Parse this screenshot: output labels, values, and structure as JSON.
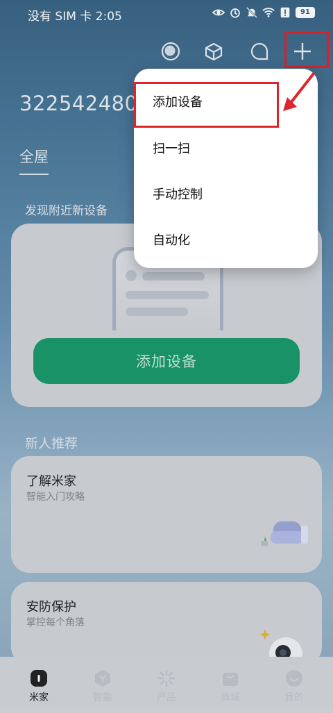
{
  "status": {
    "left_text": "没有 SIM 卡 2:05",
    "battery": "91"
  },
  "topbar": {
    "icons": [
      "ai-assistant-icon",
      "cube-icon",
      "chat-bubble-icon",
      "plus-icon"
    ]
  },
  "home": {
    "id": "3225424805",
    "room_tab": "全屋",
    "nearby_title": "发现附近新设备",
    "add_device_button": "添加设备"
  },
  "recommend": {
    "section_title": "新人推荐",
    "cards": [
      {
        "title": "了解米家",
        "subtitle": "智能入门攻略"
      },
      {
        "title": "安防保护",
        "subtitle": "掌控每个角落"
      }
    ]
  },
  "popup_menu": {
    "items": [
      "添加设备",
      "扫一扫",
      "手动控制",
      "自动化"
    ]
  },
  "bottom_nav": {
    "items": [
      {
        "label": "米家",
        "icon": "home-icon"
      },
      {
        "label": "智能",
        "icon": "smart-icon"
      },
      {
        "label": "产品",
        "icon": "product-icon"
      },
      {
        "label": "商城",
        "icon": "shop-icon"
      },
      {
        "label": "我的",
        "icon": "profile-icon"
      }
    ]
  },
  "colors": {
    "accent_green": "#1a9a6c",
    "annotation_red": "#e0242c"
  }
}
